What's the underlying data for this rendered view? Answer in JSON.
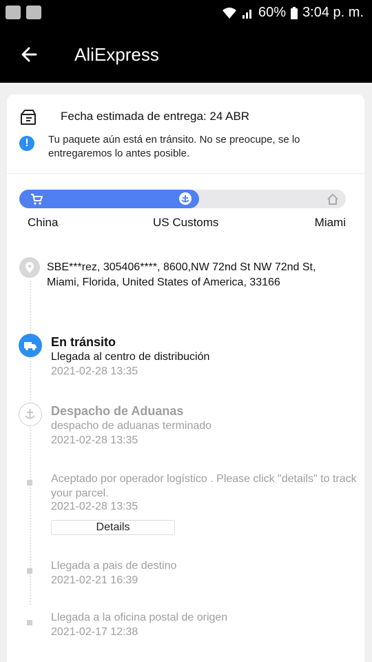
{
  "status_bar": {
    "battery": "60%",
    "time": "3:04 p. m."
  },
  "app_bar": {
    "title": "AliExpress"
  },
  "delivery": {
    "estimate": "Fecha estimada de entrega: 24 ABR",
    "notice": "Tu paquete aún está en tránsito. No se preocupe, se lo entregaremos lo antes posible."
  },
  "progress": {
    "fraction": 0.55,
    "labels": [
      "China",
      "US Customs",
      "Miami"
    ]
  },
  "address": {
    "text": "SBE***rez,  305406****,  8600,NW 72nd St NW 72nd St,  Miami,  Florida,  United States of America,  33166"
  },
  "events": [
    {
      "title": "En tránsito",
      "detail": "Llegada al centro de distribución",
      "date": "2021-02-28 13:35",
      "icon": "truck-icon"
    },
    {
      "title": "Despacho de Aduanas",
      "detail": "despacho de aduanas terminado",
      "date": "2021-02-28 13:35",
      "icon": "anchor-icon"
    },
    {
      "detail": "Aceptado por operador logístico . Please click \"details\" to track your parcel.",
      "date": "2021-02-28 13:35",
      "button": "Details"
    },
    {
      "detail": "Llegada a pais de destino",
      "date": "2021-02-21 16:39"
    },
    {
      "detail": "Llegada a la oficina postal de origen",
      "date": "2021-02-17 12:38"
    }
  ],
  "colors": {
    "accent": "#2b8ef0",
    "progress_fill": "#4f7ff0",
    "muted": "#9e9e9e"
  }
}
